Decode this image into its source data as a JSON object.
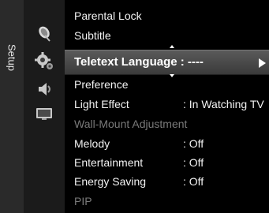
{
  "tab": {
    "label": "Setup"
  },
  "icons": [
    "satellite-dish-icon",
    "setup-gears-icon",
    "sound-speaker-icon",
    "input-screen-icon"
  ],
  "menu": {
    "items": [
      {
        "label": "Parental Lock",
        "value": "",
        "dimmed": false
      },
      {
        "label": "Subtitle",
        "value": "",
        "dimmed": false
      },
      {
        "label": "Teletext Language",
        "value": ": ----",
        "selected": true
      },
      {
        "label": "Preference",
        "value": "",
        "dimmed": false
      },
      {
        "label": "Light Effect",
        "value": ": In Watching TV",
        "dimmed": false
      },
      {
        "label": "Wall-Mount Adjustment",
        "value": "",
        "dimmed": true
      },
      {
        "label": "Melody",
        "value": ": Off",
        "dimmed": false
      },
      {
        "label": "Entertainment",
        "value": ": Off",
        "dimmed": false
      },
      {
        "label": "Energy Saving",
        "value": ": Off",
        "dimmed": false
      },
      {
        "label": "PIP",
        "value": "",
        "dimmed": true
      }
    ],
    "selected_label_combined": "Teletext Language : ----"
  },
  "colors": {
    "background": "#000000",
    "selection": "#4a4a4a",
    "text": "#f2f2f2",
    "dimmed_text": "#7a7a7a"
  }
}
